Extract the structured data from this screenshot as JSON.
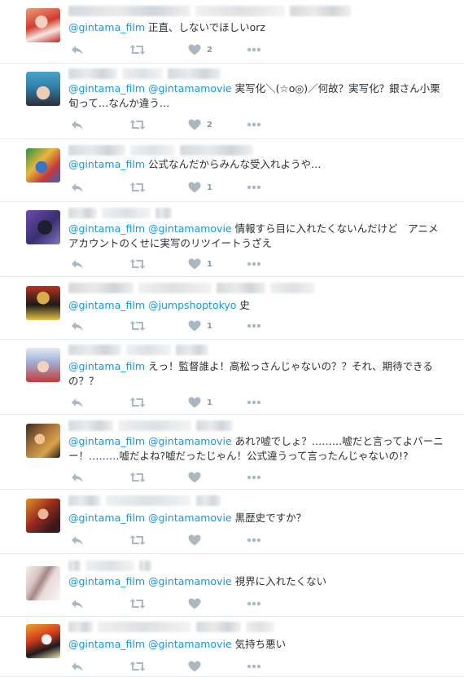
{
  "tweets": [
    {
      "mentions": [
        "@gintama_film"
      ],
      "body": "正直、しないでほしいorz",
      "likes": "2"
    },
    {
      "mentions": [
        "@gintama_film",
        "@gintamamovie"
      ],
      "body": "実写化＼(☆o◎)／何故？実写化？銀さん小栗旬って…なんか違う…",
      "likes": "2"
    },
    {
      "mentions": [
        "@gintama_film"
      ],
      "body": "公式なんだからみんな受入れようや…",
      "likes": "1"
    },
    {
      "mentions": [
        "@gintama_film",
        "@gintamamovie"
      ],
      "body": "情報すら目に入れたくないんだけど　アニメアカウントのくせに実写のリツイートうざえ",
      "likes": "1"
    },
    {
      "mentions": [
        "@gintama_film",
        "@jumpshoptokyo"
      ],
      "body": "史",
      "likes": "1"
    },
    {
      "mentions": [
        "@gintama_film"
      ],
      "body": "えっ！監督誰よ！高松っさんじゃないの？？それ、期待できるの？？",
      "likes": "1"
    },
    {
      "mentions": [
        "@gintama_film",
        "@gintamamovie"
      ],
      "body": "あれ?嘘でしょ？………嘘だと言ってよバーニー！………嘘だよね?嘘だったじゃん！公式違うって言ったんじゃないの!?",
      "likes": ""
    },
    {
      "mentions": [
        "@gintama_film",
        "@gintamamovie"
      ],
      "body": "黒歴史ですか？",
      "likes": ""
    },
    {
      "mentions": [
        "@gintama_film",
        "@gintamamovie"
      ],
      "body": "視界に入れたくない",
      "likes": ""
    },
    {
      "mentions": [
        "@gintama_film",
        "@gintamamovie"
      ],
      "body": "気持ち悪い",
      "likes": ""
    }
  ],
  "colors": {
    "link": "#1b95e0",
    "icon": "#aab8c2",
    "divider": "#e6ecf0"
  }
}
